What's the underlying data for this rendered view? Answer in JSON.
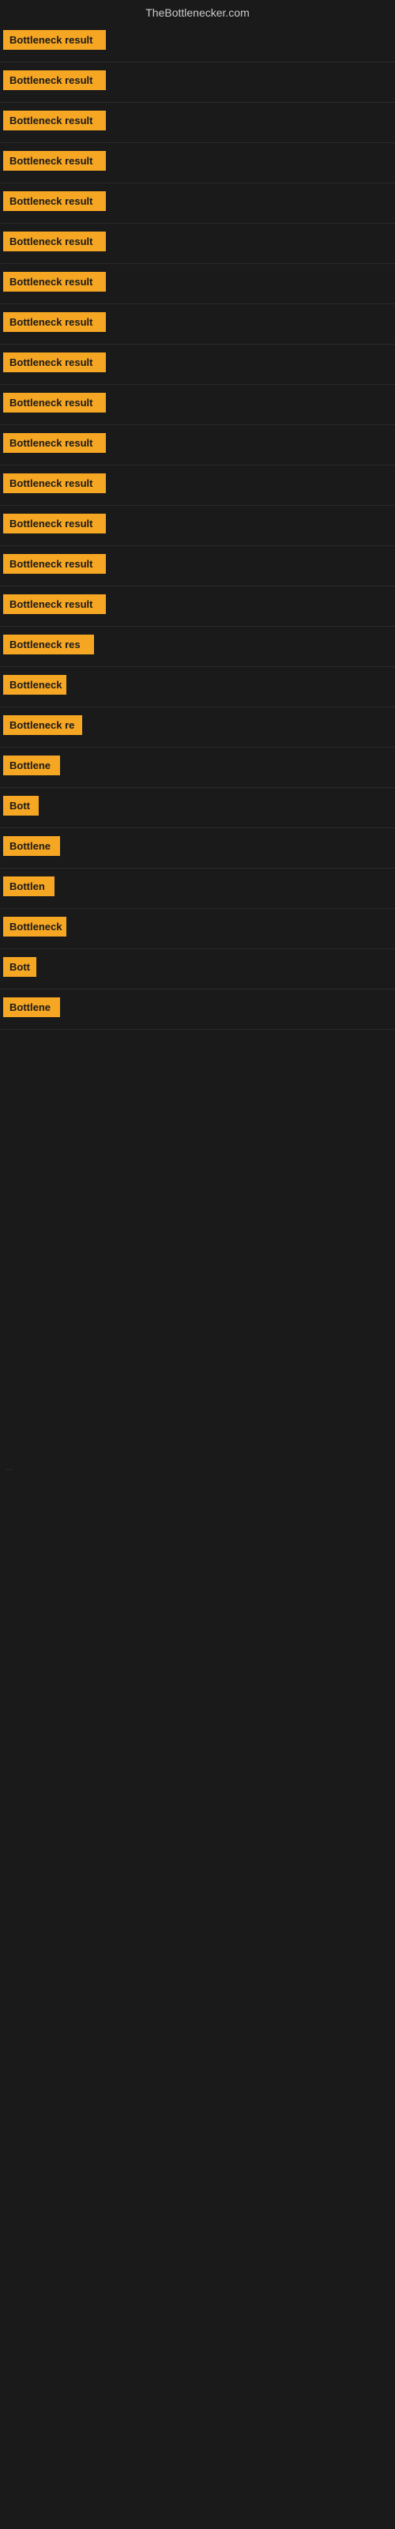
{
  "site_title": "TheBottlenecker.com",
  "cards": [
    {
      "label": "Bottleneck result",
      "width": 130
    },
    {
      "label": "Bottleneck result",
      "width": 130
    },
    {
      "label": "Bottleneck result",
      "width": 130
    },
    {
      "label": "Bottleneck result",
      "width": 130
    },
    {
      "label": "Bottleneck result",
      "width": 130
    },
    {
      "label": "Bottleneck result",
      "width": 130
    },
    {
      "label": "Bottleneck result",
      "width": 130
    },
    {
      "label": "Bottleneck result",
      "width": 130
    },
    {
      "label": "Bottleneck result",
      "width": 130
    },
    {
      "label": "Bottleneck result",
      "width": 130
    },
    {
      "label": "Bottleneck result",
      "width": 130
    },
    {
      "label": "Bottleneck result",
      "width": 130
    },
    {
      "label": "Bottleneck result",
      "width": 130
    },
    {
      "label": "Bottleneck result",
      "width": 130
    },
    {
      "label": "Bottleneck result",
      "width": 130
    },
    {
      "label": "Bottleneck res",
      "width": 115
    },
    {
      "label": "Bottleneck",
      "width": 80
    },
    {
      "label": "Bottleneck re",
      "width": 100
    },
    {
      "label": "Bottlene",
      "width": 72
    },
    {
      "label": "Bott",
      "width": 45
    },
    {
      "label": "Bottlene",
      "width": 72
    },
    {
      "label": "Bottlen",
      "width": 65
    },
    {
      "label": "Bottleneck",
      "width": 80
    },
    {
      "label": "Bott",
      "width": 42
    },
    {
      "label": "Bottlene",
      "width": 72
    }
  ],
  "ellipsis": "..."
}
